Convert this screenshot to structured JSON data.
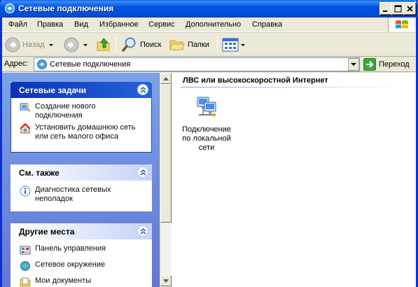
{
  "window": {
    "title": "Сетевые подключения",
    "icon": "network-connections-icon"
  },
  "menu": [
    "Файл",
    "Правка",
    "Вид",
    "Избранное",
    "Сервис",
    "Дополнительно",
    "Справка"
  ],
  "toolbar": {
    "back_label": "Назад",
    "search_label": "Поиск",
    "folders_label": "Папки"
  },
  "address": {
    "label": "Адрес:",
    "value": "Сетевые подключения",
    "go_label": "Переход"
  },
  "left": {
    "network_tasks": {
      "title": "Сетевые задачи",
      "items": [
        {
          "line1": "Создание нового",
          "line2": "подключения",
          "icon": "new-connection-icon"
        },
        {
          "line1": "Установить домашнюю сеть",
          "line2": "или сеть малого офиса",
          "icon": "home-network-icon"
        }
      ]
    },
    "see_also": {
      "title": "См. также",
      "items": [
        {
          "line1": "Диагностика сетевых",
          "line2": "неполадок",
          "icon": "info-icon"
        }
      ]
    },
    "other_places": {
      "title": "Другие места",
      "items": [
        {
          "label": "Панель управления",
          "icon": "control-panel-icon"
        },
        {
          "label": "Сетевое окружение",
          "icon": "network-places-icon"
        },
        {
          "label": "Мои документы",
          "icon": "my-documents-icon"
        }
      ]
    }
  },
  "right": {
    "group_title": "ЛВС или высокоскоростной Интернет",
    "connection": {
      "line1": "Подключение",
      "line2": "по локальной",
      "line3": "сети",
      "icon": "lan-connection-icon"
    }
  },
  "colors": {
    "titlebar": "#0053e1",
    "window_bg": "#ece9d8",
    "pane_gradient_top": "#7ba2e7",
    "pane_gradient_bottom": "#6375d6",
    "task_link": "#215dc6"
  }
}
